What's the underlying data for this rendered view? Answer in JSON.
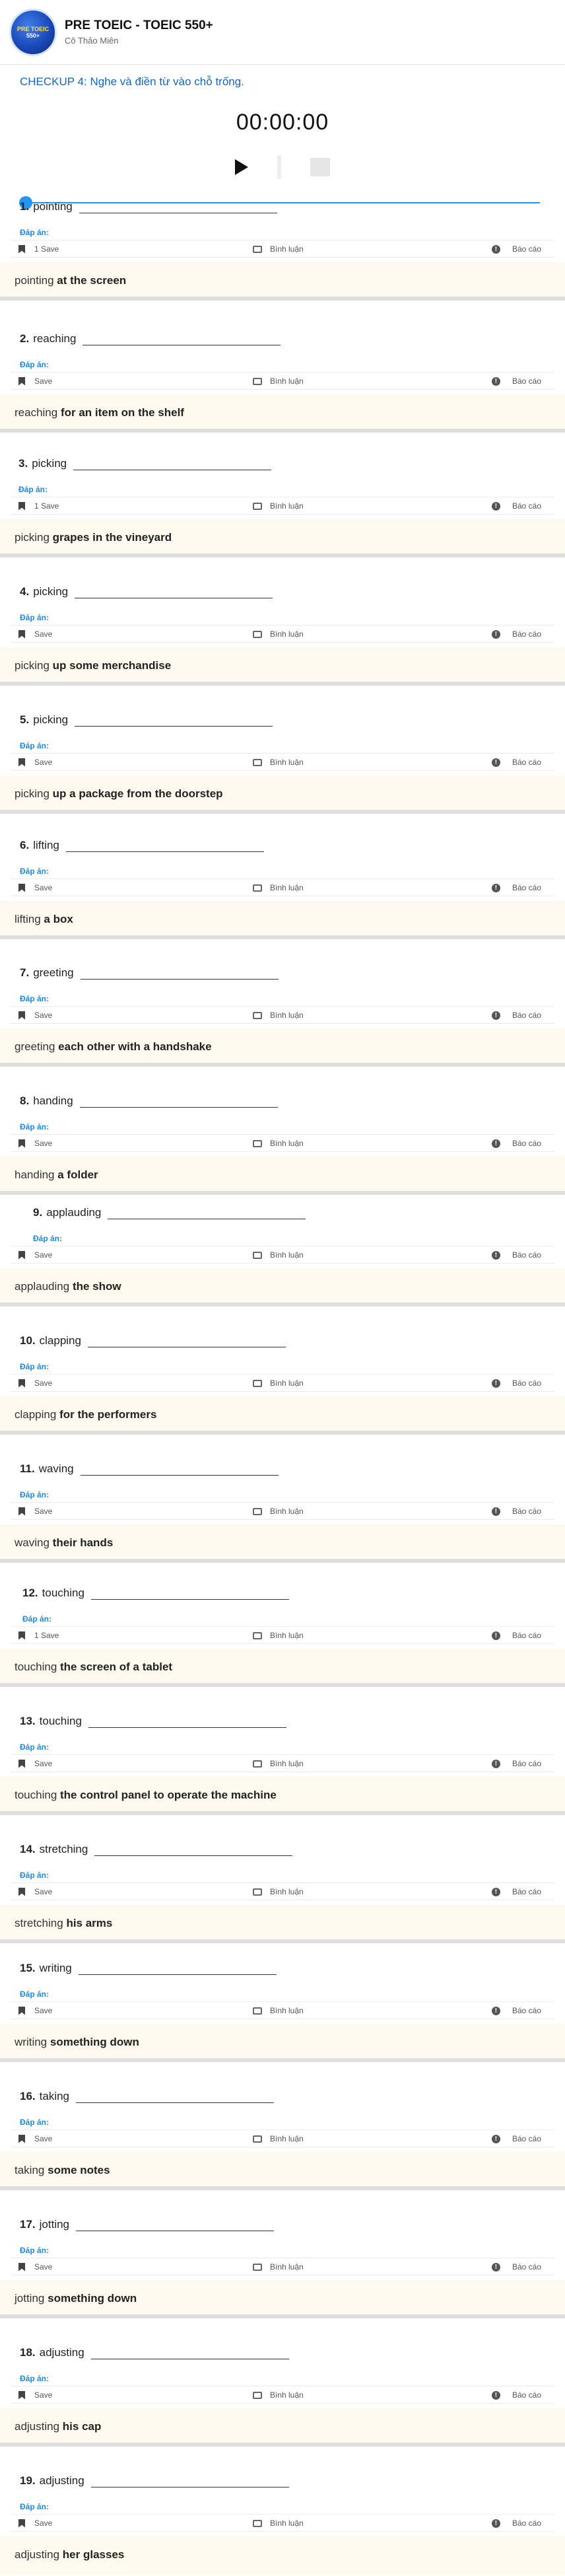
{
  "header": {
    "logo_text_top": "PRE TOEIC",
    "logo_text_bottom": "550+",
    "title": "PRE TOEIC - TOEIC 550+",
    "subtitle": "Cô Thảo Miên"
  },
  "instruction": "CHECKUP 4: Nghe và điền từ vào chỗ trống.",
  "player": {
    "time": "00:00:00",
    "progress": 0
  },
  "labels": {
    "answer_label": "Đáp án:",
    "comment": "Bình luận",
    "report": "Báo cáo"
  },
  "questions": [
    {
      "num": "1.",
      "word": "pointing",
      "save": "1 Save",
      "ans_word": "pointing",
      "ans_rest": "at the screen"
    },
    {
      "num": "2.",
      "word": "reaching",
      "save": "Save",
      "ans_word": "reaching",
      "ans_rest": "for an item on the shelf"
    },
    {
      "num": "3.",
      "word": "picking",
      "save": "1 Save",
      "ans_word": "picking",
      "ans_rest": "grapes in the vineyard"
    },
    {
      "num": "4.",
      "word": "picking",
      "save": "Save",
      "ans_word": "picking",
      "ans_rest": "up some merchandise"
    },
    {
      "num": "5.",
      "word": "picking",
      "save": "Save",
      "ans_word": "picking",
      "ans_rest": "up a package from the doorstep"
    },
    {
      "num": "6.",
      "word": "lifting",
      "save": "Save",
      "ans_word": "lifting",
      "ans_rest": "a box"
    },
    {
      "num": "7.",
      "word": "greeting",
      "save": "Save",
      "ans_word": "greeting",
      "ans_rest": "each other with a handshake"
    },
    {
      "num": "8.",
      "word": "handing",
      "save": "Save",
      "ans_word": "handing",
      "ans_rest": "a folder"
    },
    {
      "num": "9.",
      "word": "applauding",
      "save": "Save",
      "ans_word": "applauding",
      "ans_rest": "the show"
    },
    {
      "num": "10.",
      "word": "clapping",
      "save": "Save",
      "ans_word": "clapping",
      "ans_rest": "for the performers"
    },
    {
      "num": "11.",
      "word": "waving",
      "save": "Save",
      "ans_word": "waving",
      "ans_rest": "their hands"
    },
    {
      "num": "12.",
      "word": "touching",
      "save": "1 Save",
      "ans_word": "touching",
      "ans_rest": "the screen of a tablet"
    },
    {
      "num": "13.",
      "word": "touching",
      "save": "Save",
      "ans_word": "touching",
      "ans_rest": "the control panel to operate the machine"
    },
    {
      "num": "14.",
      "word": "stretching",
      "save": "Save",
      "ans_word": "stretching",
      "ans_rest": "his arms"
    },
    {
      "num": "15.",
      "word": "writing",
      "save": "Save",
      "ans_word": "writing",
      "ans_rest": "something down"
    },
    {
      "num": "16.",
      "word": "taking",
      "save": "Save",
      "ans_word": "taking",
      "ans_rest": "some notes"
    },
    {
      "num": "17.",
      "word": "jotting",
      "save": "Save",
      "ans_word": "jotting",
      "ans_rest": "something down"
    },
    {
      "num": "18.",
      "word": "adjusting",
      "save": "Save",
      "ans_word": "adjusting",
      "ans_rest": "his cap"
    },
    {
      "num": "19.",
      "word": "adjusting",
      "save": "Save",
      "ans_word": "adjusting",
      "ans_rest": "her glasses"
    }
  ]
}
